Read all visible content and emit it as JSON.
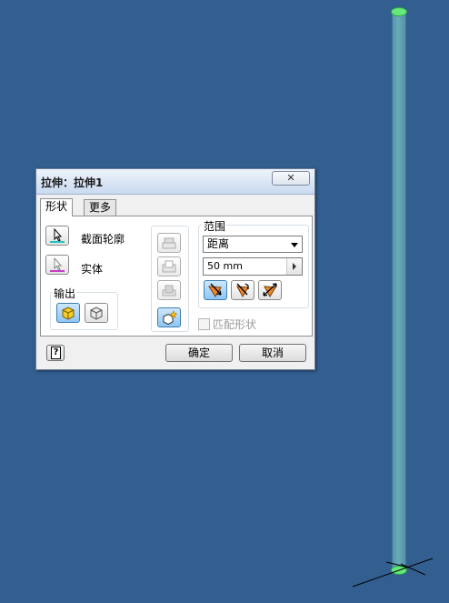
{
  "dialog": {
    "title": "拉伸：拉伸1",
    "close_glyph": "✕"
  },
  "tabs": [
    {
      "label": "形状",
      "active": true
    },
    {
      "label": "更多",
      "active": false
    }
  ],
  "shape": {
    "profile_label": "截面轮廓",
    "solid_label": "实体",
    "output_group_title": "输出"
  },
  "extents": {
    "group_title": "范围",
    "type_value": "距离",
    "distance_value": "50 mm",
    "match_shape_label": "匹配形状"
  },
  "footer": {
    "ok_label": "确定",
    "cancel_label": "取消",
    "help_glyph": "?"
  },
  "colors": {
    "viewport_bg": "#335f90",
    "cylinder_edge": "#66e87a",
    "selected_button": "#8ec6f5"
  },
  "icons": {
    "profile_select": "cursor-arrow-icon",
    "solid_select": "cursor-arrow-icon",
    "output_solid": "solid-cube-icon",
    "output_surface": "surface-cube-icon",
    "join": "join-icon",
    "cut": "cut-icon",
    "intersect": "intersect-icon",
    "new_solid": "new-solid-icon",
    "direction_1": "direction-1-icon",
    "direction_2": "direction-2-icon",
    "symmetric": "symmetric-icon"
  }
}
